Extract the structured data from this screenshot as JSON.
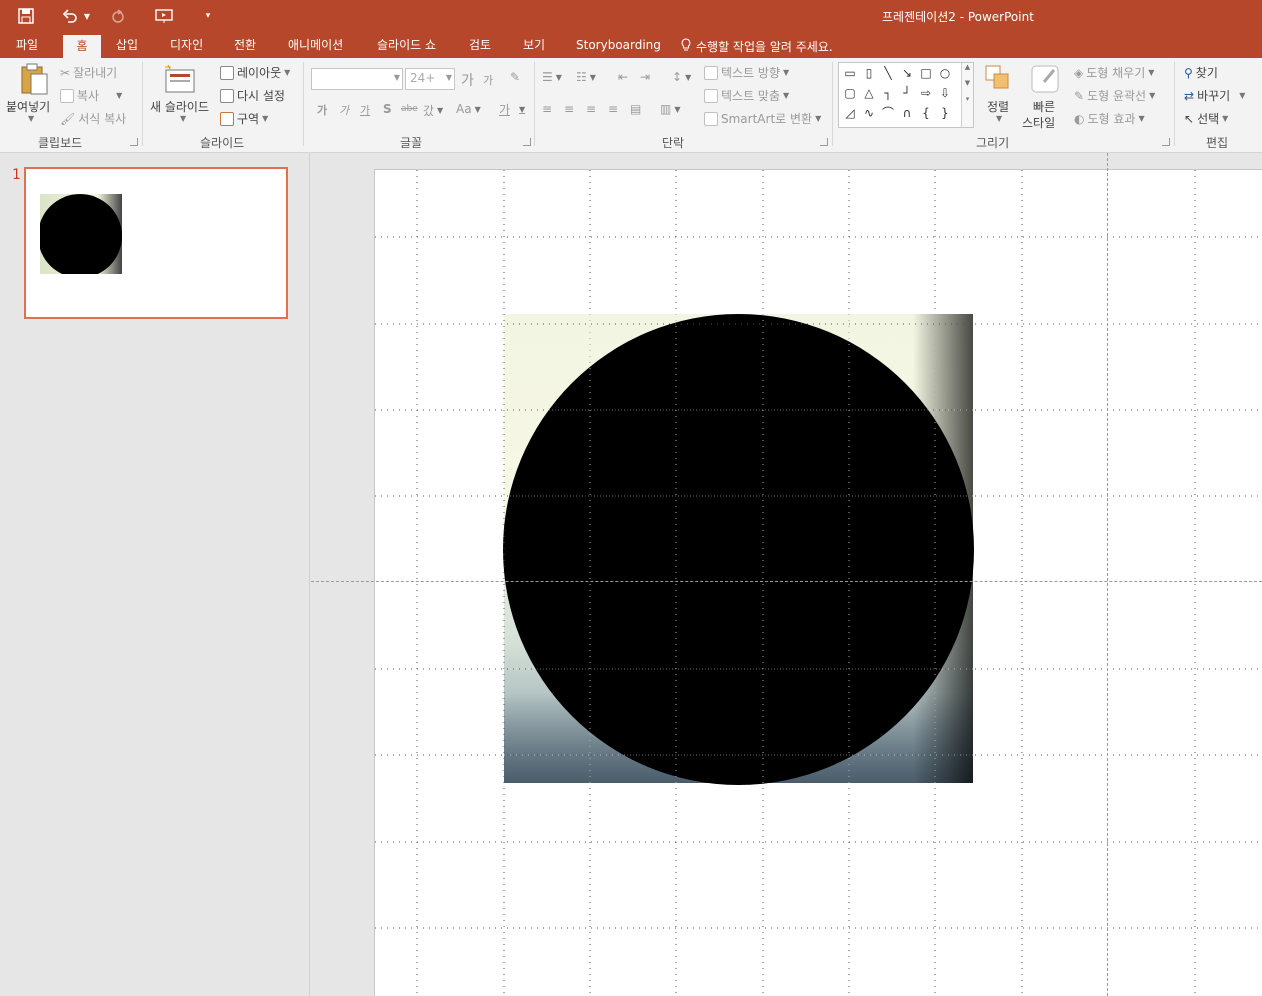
{
  "window": {
    "title": "프레젠테이션2 - PowerPoint",
    "accent": "#b7472a"
  },
  "qat": {
    "icons": [
      "save-icon",
      "undo-icon",
      "redo-icon",
      "start-from-beginning-icon",
      "customize-qat-icon"
    ]
  },
  "tabs": [
    {
      "label": "파일"
    },
    {
      "label": "홈",
      "active": true
    },
    {
      "label": "삽입"
    },
    {
      "label": "디자인"
    },
    {
      "label": "전환"
    },
    {
      "label": "애니메이션"
    },
    {
      "label": "슬라이드 쇼"
    },
    {
      "label": "검토"
    },
    {
      "label": "보기"
    },
    {
      "label": "Storyboarding"
    }
  ],
  "tell_me": "수행할 작업을 알려 주세요.",
  "ribbon": {
    "clipboard": {
      "label": "클립보드",
      "paste": "붙여넣기",
      "cut": "잘라내기",
      "copy": "복사",
      "format_painter": "서식 복사"
    },
    "slides": {
      "label": "슬라이드",
      "new_slide": "새 슬라이드",
      "layout": "레이아웃",
      "reset": "다시 설정",
      "section": "구역"
    },
    "font": {
      "label": "글꼴",
      "font_name": "",
      "font_size": "24+",
      "grow": "가",
      "shrink": "가",
      "bold": "가",
      "italic": "가",
      "underline": "가",
      "shadow": "S",
      "strike": "abe",
      "spacing": "갔",
      "case": "Aa",
      "color": "가"
    },
    "paragraph": {
      "label": "단락",
      "text_direction": "텍스트 방향",
      "align_text": "텍스트 맞춤",
      "smartart": "SmartArt로 변환"
    },
    "drawing": {
      "label": "그리기",
      "arrange": "정렬",
      "quick_styles_1": "빠른",
      "quick_styles_2": "스타일",
      "shape_fill": "도형 채우기",
      "shape_outline": "도형 윤곽선",
      "shape_effects": "도형 효과"
    },
    "editing": {
      "label": "편집",
      "find": "찾기",
      "replace": "바꾸기",
      "select": "선택"
    }
  },
  "thumbnails": [
    {
      "number": "1"
    }
  ]
}
